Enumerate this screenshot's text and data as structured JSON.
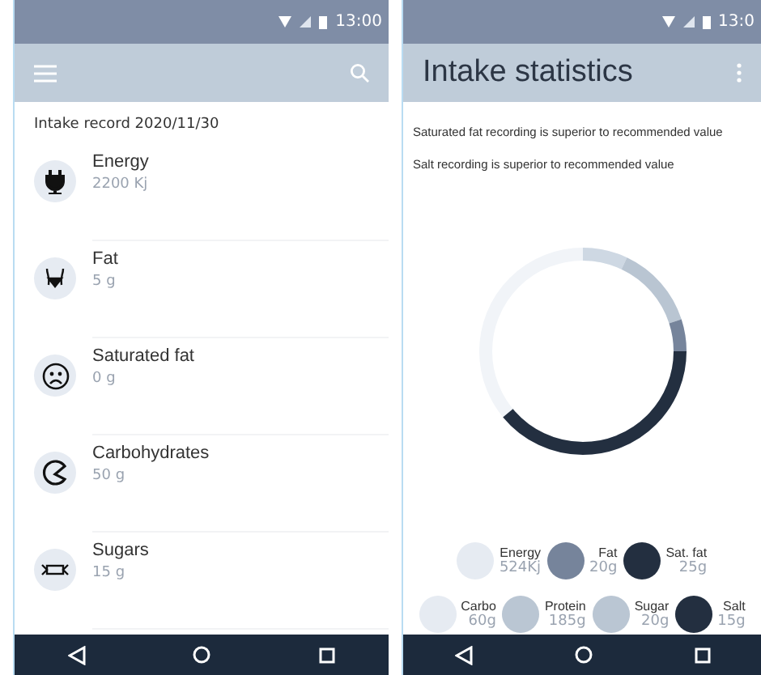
{
  "left_screen": {
    "status_bar": {
      "time": "13:00"
    },
    "record_title": "Intake record  2020/11/30",
    "items": [
      {
        "name": "Energy",
        "amount": "2200 Kj"
      },
      {
        "name": "Fat",
        "amount": "5 g"
      },
      {
        "name": "Saturated fat",
        "amount": "0 g"
      },
      {
        "name": "Carbohydrates",
        "amount": "50 g"
      },
      {
        "name": "Sugars",
        "amount": "15 g"
      }
    ]
  },
  "right_screen": {
    "status_bar": {
      "time": "13:0"
    },
    "title": "Intake statistics",
    "warnings": [
      "Saturated fat recording is superior to recommended value",
      "Salt recording is superior to recommended value"
    ],
    "legend": [
      [
        {
          "name": "Energy",
          "amount": "524Kj",
          "color": "#e6ebf2"
        },
        {
          "name": "Fat",
          "amount": "20g",
          "color": "#76849b"
        },
        {
          "name": "Sat. fat",
          "amount": "25g",
          "color": "#232f40"
        }
      ],
      [
        {
          "name": "Carbo",
          "amount": "60g",
          "color": "#e6ebf2"
        },
        {
          "name": "Protein",
          "amount": "185g",
          "color": "#bac6d3"
        },
        {
          "name": "Sugar",
          "amount": "20g",
          "color": "#bac6d3"
        },
        {
          "name": "Salt",
          "amount": "15g",
          "color": "#232f40"
        }
      ]
    ]
  }
}
